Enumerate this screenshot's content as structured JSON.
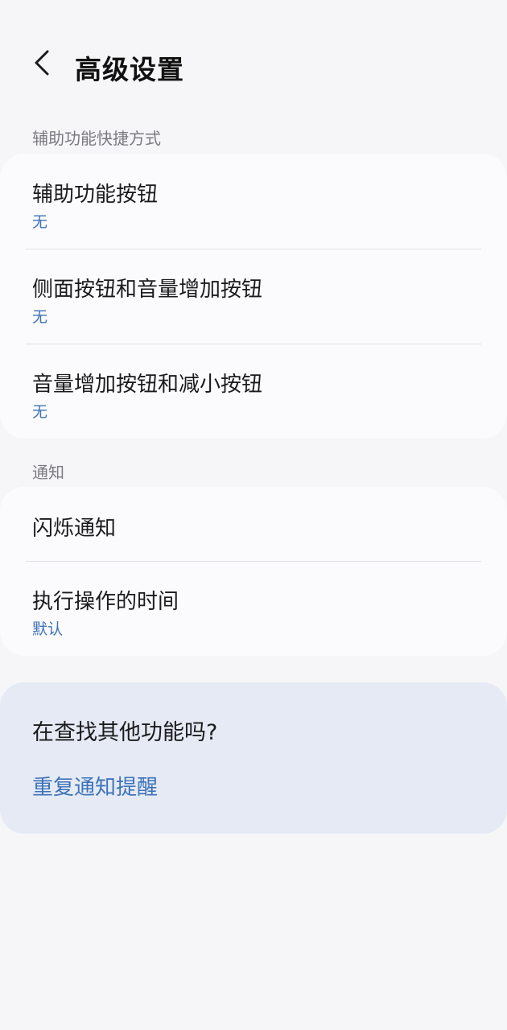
{
  "header": {
    "back_icon": "chevron-left-icon",
    "title": "高级设置"
  },
  "shortcuts_section": {
    "label": "辅助功能快捷方式",
    "items": [
      {
        "title": "辅助功能按钮",
        "value": "无"
      },
      {
        "title": "侧面按钮和音量增加按钮",
        "value": "无"
      },
      {
        "title": "音量增加按钮和减小按钮",
        "value": "无"
      }
    ]
  },
  "notification_section": {
    "label": "通知",
    "items": [
      {
        "title": "闪烁通知"
      },
      {
        "title": "执行操作的时间",
        "value": "默认"
      }
    ]
  },
  "suggestion": {
    "title": "在查找其他功能吗?",
    "link": "重复通知提醒"
  },
  "colors": {
    "background": "#f6f6f8",
    "card": "#fbfbfd",
    "suggestion_card": "#e5eaf5",
    "accent": "#3d73b8",
    "secondary_text": "#7a7a80"
  }
}
